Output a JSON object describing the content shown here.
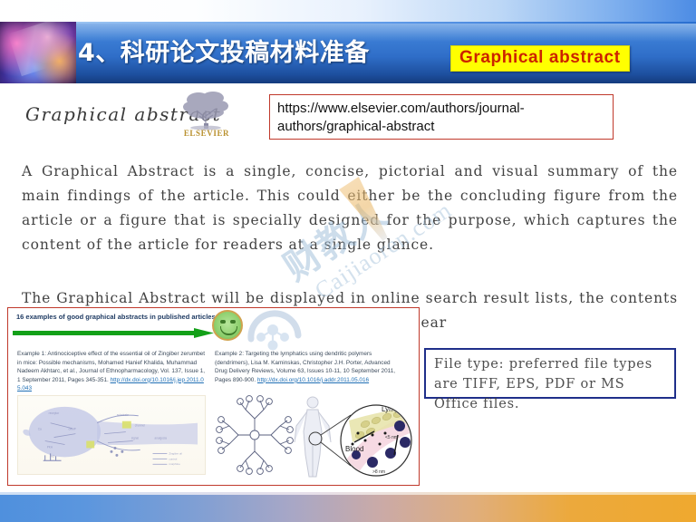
{
  "header": {
    "title": "4、科研论文投稿材料准备",
    "badge": "Graphical  abstract",
    "thumbnail_icon": "abstract-photo-thumbnail",
    "colors": {
      "band_start": "#4f8fe0",
      "band_end": "#143b7d",
      "badge_bg": "#ffff00",
      "badge_text": "#cc2200"
    }
  },
  "content": {
    "section_title": "Graphical abstract",
    "elsevier_logo": {
      "icon": "elsevier-tree-logo",
      "wordmark": "ELSEVIER",
      "color": "#b9912f"
    },
    "url_box": {
      "url": "https://www.elsevier.com/authors/journal-authors/graphical-abstract",
      "border_color": "#c0392b"
    },
    "paragraph_1": "A Graphical Abstract is a single, concise, pictorial and visual summary of the main findings of the article. This could either be the concluding figure from the article or a figure that is specially designed for the purpose, which captures the content of the article for readers at a single glance.",
    "paragraph_2": "The Graphical Abstract will be displayed in online search result lists, the contents list and in the online article, but will not (yet) appear",
    "file_type_box": {
      "text": "File type: preferred file types are TIFF, EPS, PDF or MS Office files.",
      "border_color": "#1f2f8a"
    }
  },
  "screenshot": {
    "heading": "16 examples of good graphical abstracts in published articles",
    "arrow_icon": "green-right-arrow",
    "smiley_icon": "green-smiley-face-icon",
    "faded_logo_icon": "faded-molecule-logo",
    "border_color": "#c0392b",
    "examples": [
      {
        "text": "Example 1: Antinociceptive effect of the essential oil of Zingiber zerumbet in mice: Possible mechanisms, Mohamed Hanief Khalida, Muhammad Nadeem Akhtarc, et al., Journal of Ethnopharmacology, Vol. 137, Issue 1, 1 September 2011, Pages 345-351.",
        "doi": "http://dx.doi.org/10.1016/j.jep.2011.05.043",
        "figure_icon": "neuron-synapse-diagram"
      },
      {
        "text": "Example 2: Targeting the lymphatics using dendritic polymers (dendrimers), Lisa M. Kaminskas, Christopher J.H. Porter, Advanced Drug Delivery Reviews, Volume 63, Issues 10-11, 10 September 2011, Pages 890-900.",
        "doi": "http://dx.doi.org/10.1016/j.addr.2011.05.016",
        "figure_icon": "dendrimer-lymphatic-diagram",
        "figure_labels": [
          "Lymph",
          "Blood"
        ]
      }
    ]
  },
  "watermark": {
    "chinese": "财教人",
    "latin": "Caijiaoren.com"
  },
  "footer": {
    "gradient_start": "#4f90dd",
    "gradient_end": "#efa92f"
  }
}
